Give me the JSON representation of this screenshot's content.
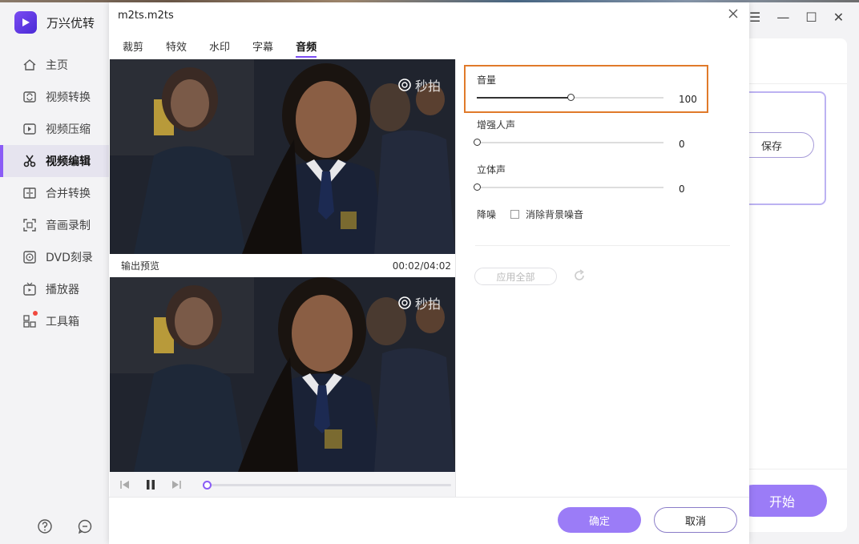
{
  "app": {
    "name": "万兴优转"
  },
  "sidebar": {
    "items": [
      {
        "label": "主页",
        "icon": "home-icon"
      },
      {
        "label": "视频转换",
        "icon": "convert-icon"
      },
      {
        "label": "视频压缩",
        "icon": "compress-icon"
      },
      {
        "label": "视频编辑",
        "icon": "scissors-icon",
        "active": true
      },
      {
        "label": "合并转换",
        "icon": "merge-icon"
      },
      {
        "label": "音画录制",
        "icon": "record-icon"
      },
      {
        "label": "DVD刻录",
        "icon": "dvd-icon"
      },
      {
        "label": "播放器",
        "icon": "player-icon"
      },
      {
        "label": "工具箱",
        "icon": "toolbox-icon"
      }
    ],
    "bottom_icons": [
      "help-icon",
      "feedback-icon"
    ]
  },
  "background": {
    "save_label": "保存",
    "start_label": "开始"
  },
  "dialog": {
    "title": "m2ts.m2ts",
    "tabs": [
      "裁剪",
      "特效",
      "水印",
      "字幕",
      "音频"
    ],
    "active_tab": "音频",
    "watermark": "秒拍",
    "preview_label": "输出预览",
    "time": "00:02/04:02",
    "settings": {
      "volume": {
        "label": "音量",
        "value": "100",
        "level": 0.5
      },
      "voice_enhance": {
        "label": "增强人声",
        "value": "0",
        "level": 0
      },
      "stereo": {
        "label": "立体声",
        "value": "0",
        "level": 0
      },
      "denoise": {
        "label": "降噪",
        "checkbox_label": "消除背景噪音",
        "checked": false
      }
    },
    "apply_all_label": "应用全部",
    "ok_label": "确定",
    "cancel_label": "取消"
  },
  "colors": {
    "accent": "#8a5cf6",
    "button": "#9b7cf7",
    "highlight": "#e07a2a"
  }
}
